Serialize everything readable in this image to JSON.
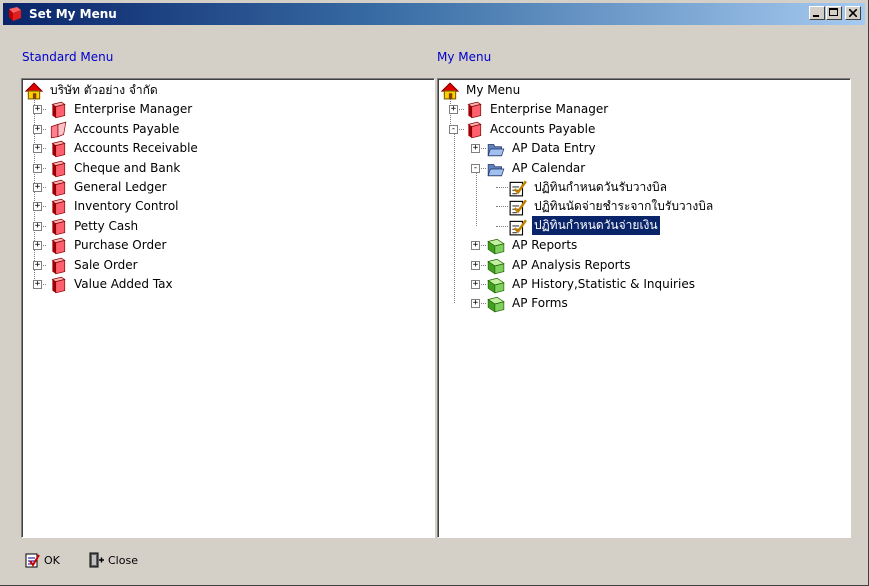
{
  "window": {
    "title": "Set My Menu"
  },
  "standard": {
    "heading": "Standard Menu",
    "root": "บริษัท ตัวอย่าง จำกัด",
    "items": [
      {
        "label": "Enterprise Manager",
        "icon": "book-icon"
      },
      {
        "label": "Accounts Payable",
        "icon": "open-book-icon"
      },
      {
        "label": "Accounts Receivable",
        "icon": "book-icon"
      },
      {
        "label": "Cheque and Bank",
        "icon": "book-icon"
      },
      {
        "label": "General Ledger",
        "icon": "book-icon"
      },
      {
        "label": "Inventory Control",
        "icon": "book-icon"
      },
      {
        "label": "Petty Cash",
        "icon": "book-icon"
      },
      {
        "label": "Purchase Order",
        "icon": "book-icon"
      },
      {
        "label": "Sale Order",
        "icon": "book-icon"
      },
      {
        "label": "Value Added Tax",
        "icon": "book-icon"
      }
    ]
  },
  "mymenu": {
    "heading": "My Menu",
    "root": "My Menu",
    "items": [
      {
        "label": "Enterprise Manager"
      },
      {
        "label": "Accounts Payable"
      },
      {
        "label": "AP Data Entry"
      },
      {
        "label": "AP Calendar"
      },
      {
        "label": "ปฏิทินกำหนดวันรับวางบิล"
      },
      {
        "label": "ปฏิทินนัดจ่ายชำระจากใบรับวางบิล"
      },
      {
        "label": "ปฏิทินกำหนดวันจ่ายเงิน"
      },
      {
        "label": "AP Reports"
      },
      {
        "label": "AP Analysis Reports"
      },
      {
        "label": "AP History,Statistic & Inquiries"
      },
      {
        "label": "AP Forms"
      }
    ]
  },
  "buttons": {
    "ok": "OK",
    "close": "Close"
  },
  "colors": {
    "title_start": "#0a246a",
    "title_end": "#a6caf0",
    "heading": "#0000cc",
    "selection": "#0a246a"
  }
}
